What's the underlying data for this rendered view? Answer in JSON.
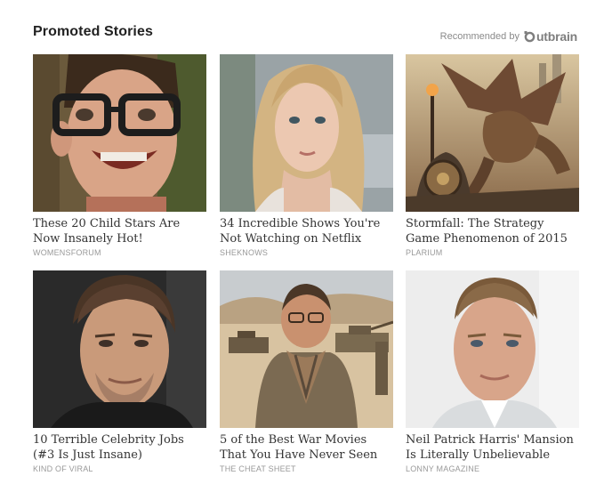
{
  "widget": {
    "title": "Promoted Stories",
    "recommended_label": "Recommended by",
    "brand_name": "utbrain",
    "brand_icon": "outbrain-logo-icon"
  },
  "cards": [
    {
      "headline": "These 20 Child Stars Are Now Insanely Hot!",
      "source": "WOMENSFORUM",
      "image": "smiling-boy-with-glasses"
    },
    {
      "headline": "34 Incredible Shows You're Not Watching on Netflix",
      "source": "SHEKNOWS",
      "image": "blonde-woman-portrait"
    },
    {
      "headline": "Stormfall: The Strategy Game Phenomenon of 2015",
      "source": "PLARIUM",
      "image": "dragon-and-warrior-artwork"
    },
    {
      "headline": "10 Terrible Celebrity Jobs (#3 Is Just Insane)",
      "source": "KIND OF VIRAL",
      "image": "man-portrait-dark-background"
    },
    {
      "headline": "5 of the Best War Movies That You Have Never Seen",
      "source": "THE CHEAT SHEET",
      "image": "soldier-in-desert-with-tanks"
    },
    {
      "headline": "Neil Patrick Harris' Mansion Is Literally Unbelievable",
      "source": "LONNY MAGAZINE",
      "image": "man-portrait-light-background"
    }
  ]
}
